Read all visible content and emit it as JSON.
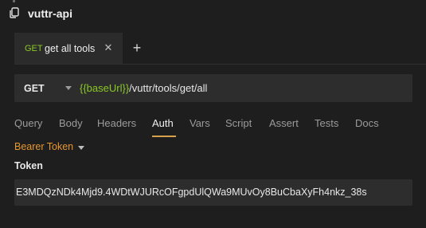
{
  "collection": {
    "name": "vuttr-api",
    "icon": "collection-copy-icon"
  },
  "tabs": [
    {
      "method": "GET",
      "label": "get all tools",
      "close_icon": "close-icon",
      "active": true
    }
  ],
  "tab_add_icon": "plus-icon",
  "request": {
    "method": "GET",
    "url_variable": "{{baseUrl}}",
    "url_path": "/vuttr/tools/get/all"
  },
  "pane_tabs": {
    "query": "Query",
    "body": "Body",
    "headers": "Headers",
    "auth": "Auth",
    "vars": "Vars",
    "script": "Script",
    "assert": "Assert",
    "tests": "Tests",
    "docs": "Docs",
    "active": "Auth"
  },
  "auth": {
    "mode": "Bearer Token",
    "token_label": "Token",
    "token_value": "E3MDQzNDk4Mjd9.4WDtWJURcOFgpdUlQWa9MUvOy8BuCbaXyFh4nkz_38s"
  },
  "colors": {
    "method_get": "#8ac926",
    "url_variable": "#8ac926",
    "auth_mode": "#e8962e",
    "active_tab_underline": "#d9a24a",
    "background": "#1e1e1e",
    "field_background": "#2d2d2d"
  }
}
